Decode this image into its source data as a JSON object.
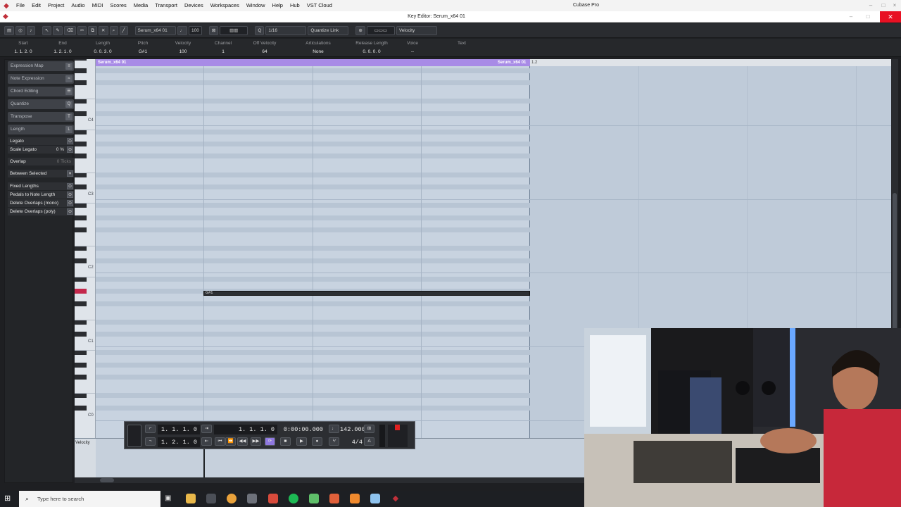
{
  "menubar": {
    "items": [
      "File",
      "Edit",
      "Project",
      "Audio",
      "MIDI",
      "Scores",
      "Media",
      "Transport",
      "Devices",
      "Workspaces",
      "Window",
      "Help",
      "Hub",
      "VST Cloud"
    ],
    "app_title": "Cubase Pro"
  },
  "editor": {
    "title": "Key Editor: Serum_x64 01"
  },
  "toolbar": {
    "track_name": "Serum_x64 01",
    "velocity_value": "100",
    "quantize": "1/16",
    "quantize_link": "Quantize Link",
    "controller_lane": "Velocity"
  },
  "infoline": {
    "fields": [
      {
        "label": "Start",
        "value": "1. 1. 2. 0"
      },
      {
        "label": "End",
        "value": "1. 2. 1. 0"
      },
      {
        "label": "Length",
        "value": "0. 0. 3. 0"
      },
      {
        "label": "Pitch",
        "value": "G#1"
      },
      {
        "label": "Velocity",
        "value": "100"
      },
      {
        "label": "Channel",
        "value": "1"
      },
      {
        "label": "Off Velocity",
        "value": "64"
      },
      {
        "label": "Articulations",
        "value": "None"
      },
      {
        "label": "Release Length",
        "value": "0. 0. 0. 0"
      },
      {
        "label": "Voice",
        "value": "--"
      },
      {
        "label": "Text",
        "value": ""
      }
    ]
  },
  "inspector": {
    "sections": [
      "Expression Map",
      "Note Expression",
      "Chord Editing",
      "Quantize",
      "Transpose",
      "Length"
    ],
    "length_rows": [
      {
        "label": "Legato",
        "value": ""
      },
      {
        "label": "Scale Legato",
        "value": "0 %"
      },
      {
        "label": "Overlap",
        "value": "0 Ticks"
      },
      {
        "label": "Between Selected",
        "value": ""
      }
    ],
    "action_rows": [
      "Fixed Lengths",
      "Pedals to Note Length",
      "Delete Overlaps (mono)",
      "Delete Overlaps (poly)"
    ]
  },
  "keyboard": {
    "octaves": [
      "C4",
      "C3",
      "C2",
      "C1",
      "C0"
    ]
  },
  "ruler": {
    "part_start_label": "Serum_x64 01",
    "part_end_label": "Serum_x64 01",
    "marker": "1.2"
  },
  "note": {
    "label": "G#1",
    "velocity": 100
  },
  "controller": {
    "label": "Velocity"
  },
  "transport": {
    "left_locator": "1. 1. 1. 0",
    "right_locator": "1. 2. 1. 0",
    "position_bars": "1. 1. 1. 0",
    "position_time": "0:00:00.000",
    "tempo": "142.000",
    "signature": "4/4"
  },
  "taskbar": {
    "search_placeholder": "Type here to search"
  },
  "colors": {
    "part_color": "#a88be6",
    "highlight_key": "#c4284c",
    "close_button": "#e81123"
  }
}
